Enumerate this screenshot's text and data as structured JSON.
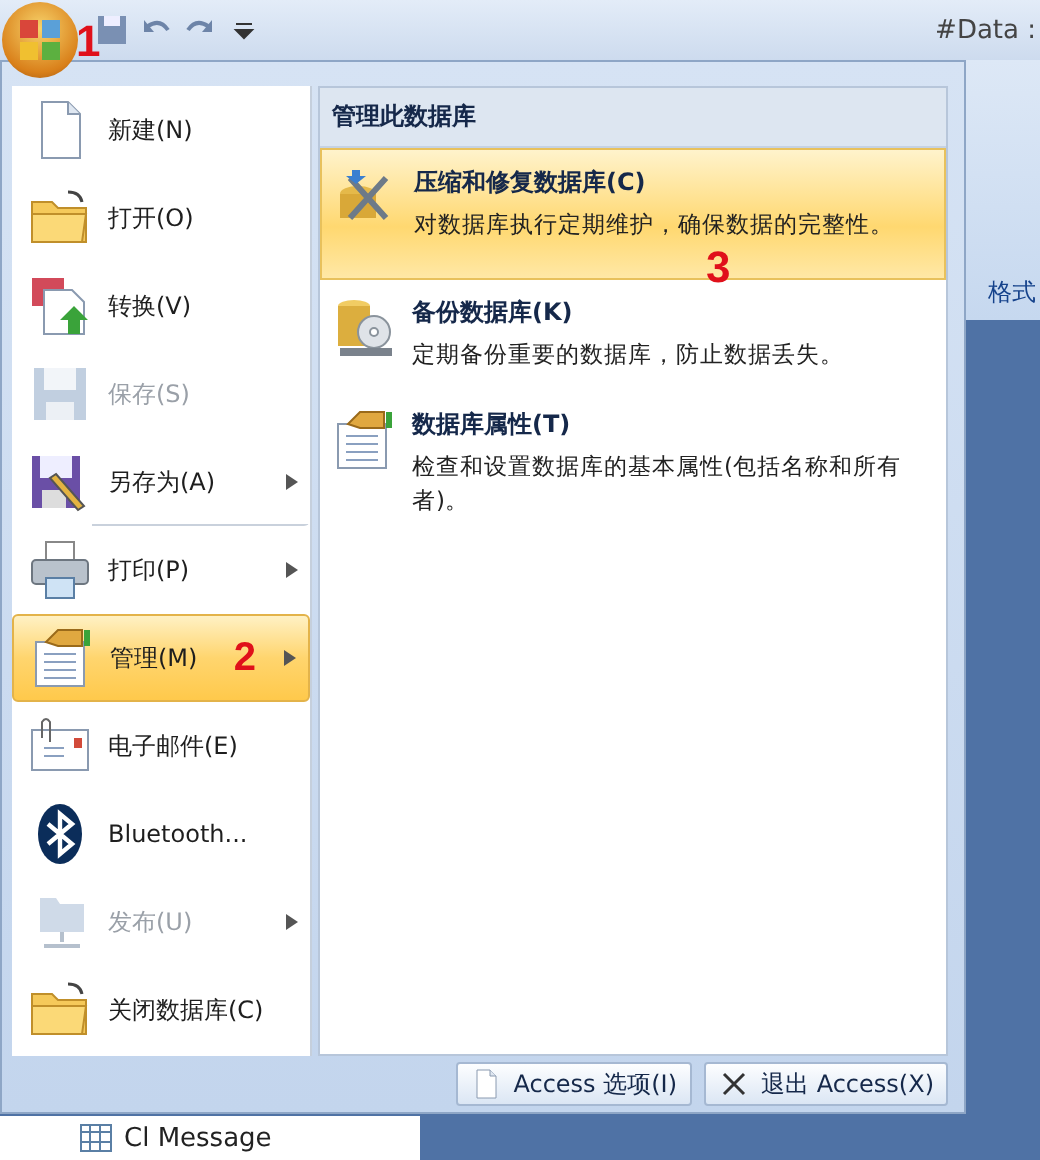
{
  "title_bar": {
    "title": "#Data :"
  },
  "office_button": {
    "callout": "1"
  },
  "ribbon": {
    "label": "格式"
  },
  "navigation": {
    "item": "Cl Message"
  },
  "menu": {
    "left_items": [
      {
        "label": "新建(N)",
        "kind": "new",
        "disabled": false,
        "submenu": false,
        "selected": false,
        "separator_after": false
      },
      {
        "label": "打开(O)",
        "kind": "open",
        "disabled": false,
        "submenu": false,
        "selected": false,
        "separator_after": false
      },
      {
        "label": "转换(V)",
        "kind": "convert",
        "disabled": false,
        "submenu": false,
        "selected": false,
        "separator_after": false
      },
      {
        "label": "保存(S)",
        "kind": "save",
        "disabled": true,
        "submenu": false,
        "selected": false,
        "separator_after": false
      },
      {
        "label": "另存为(A)",
        "kind": "saveas",
        "disabled": false,
        "submenu": true,
        "selected": false,
        "separator_after": true
      },
      {
        "label": "打印(P)",
        "kind": "print",
        "disabled": false,
        "submenu": true,
        "selected": false,
        "separator_after": false
      },
      {
        "label": "管理(M)",
        "kind": "manage",
        "disabled": false,
        "submenu": true,
        "selected": true,
        "separator_after": false,
        "callout": "2"
      },
      {
        "label": "电子邮件(E)",
        "kind": "email",
        "disabled": false,
        "submenu": false,
        "selected": false,
        "separator_after": false
      },
      {
        "label": "Bluetooth...",
        "kind": "bluetooth",
        "disabled": false,
        "submenu": false,
        "selected": false,
        "separator_after": false
      },
      {
        "label": "发布(U)",
        "kind": "publish",
        "disabled": true,
        "submenu": true,
        "selected": false,
        "separator_after": false
      },
      {
        "label": "关闭数据库(C)",
        "kind": "close",
        "disabled": false,
        "submenu": false,
        "selected": false,
        "separator_after": false
      }
    ],
    "submenu": {
      "header": "管理此数据库",
      "items": [
        {
          "title": "压缩和修复数据库(C)",
          "description": "对数据库执行定期维护，确保数据的完整性。",
          "kind": "compress",
          "selected": true,
          "callout": "3"
        },
        {
          "title": "备份数据库(K)",
          "description": "定期备份重要的数据库，防止数据丢失。",
          "kind": "backup",
          "selected": false
        },
        {
          "title": "数据库属性(T)",
          "description": "检查和设置数据库的基本属性(包括名称和所有者)。",
          "kind": "properties",
          "selected": false
        }
      ]
    },
    "footer_buttons": [
      {
        "label": "Access 选项(I)",
        "kind": "options"
      },
      {
        "label": "退出 Access(X)",
        "kind": "exit"
      }
    ]
  }
}
